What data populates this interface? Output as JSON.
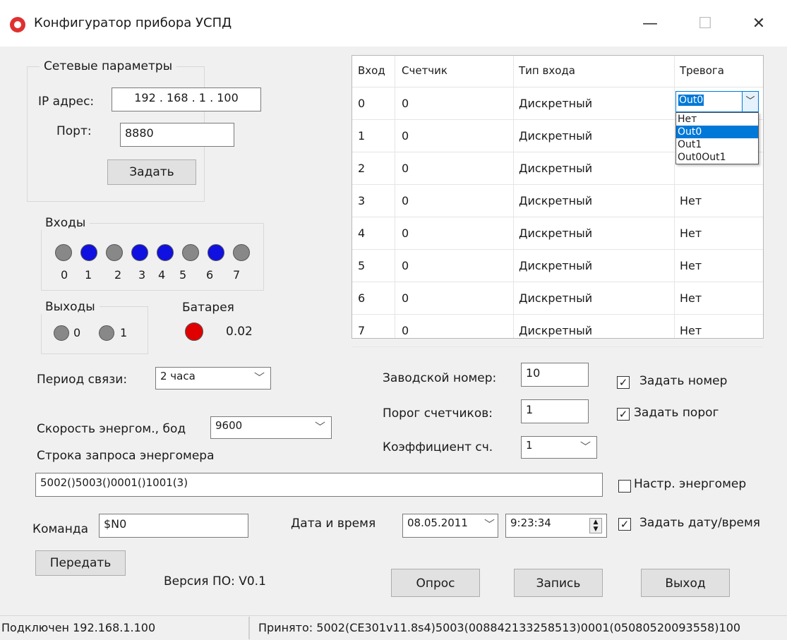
{
  "window": {
    "title": "Конфигуратор прибора УСПД",
    "minimize": "—",
    "maximize": "☐",
    "close": "✕"
  },
  "network": {
    "label": "Сетевые параметры",
    "ip_label": "IP адрес:",
    "ip_value": "192 . 168 .  1   . 100",
    "port_label": "Порт:",
    "port_value": "8880",
    "set_button": "Задать"
  },
  "inputs": {
    "label": "Входы",
    "numbers": [
      "0",
      "1",
      "2",
      "3",
      "4",
      "5",
      "6",
      "7"
    ],
    "states": [
      "off",
      "on",
      "off",
      "on",
      "on",
      "off",
      "on",
      "off"
    ]
  },
  "outputs": {
    "label": "Выходы",
    "numbers": [
      "0",
      "1"
    ]
  },
  "battery": {
    "label": "Батарея",
    "value": "0.02"
  },
  "period": {
    "label": "Период связи:",
    "value": "2 часа"
  },
  "baud": {
    "label": "Скорость энергом., бод",
    "value": "9600"
  },
  "request": {
    "label": "Строка запроса энергомера",
    "value": "5002()5003()0001()1001(3)"
  },
  "command": {
    "label": "Команда",
    "value": "$N0",
    "send_button": "Передать"
  },
  "version": "Версия ПО: V0.1",
  "serial": {
    "label": "Заводской номер:",
    "value": "10",
    "check_label": "Задать номер",
    "checked": true
  },
  "threshold": {
    "label": "Порог счетчиков:",
    "value": "1",
    "check_label": "Задать порог",
    "checked": true
  },
  "coef": {
    "label": "Коэффициент сч.",
    "value": "1"
  },
  "meter_setup": {
    "label": "Настр. энергомер",
    "checked": false
  },
  "datetime": {
    "label": "Дата и время",
    "date": "08.05.2011",
    "time": "9:23:34",
    "check_label": "Задать дату/время",
    "checked": true
  },
  "buttons": {
    "poll": "Опрос",
    "write": "Запись",
    "exit": "Выход"
  },
  "table": {
    "headers": [
      "Вход",
      "Счетчик",
      "Тип входа",
      "Тревога"
    ],
    "rows": [
      [
        "0",
        "0",
        "Дискретный",
        "Out0"
      ],
      [
        "1",
        "0",
        "Дискретный",
        ""
      ],
      [
        "2",
        "0",
        "Дискретный",
        ""
      ],
      [
        "3",
        "0",
        "Дискретный",
        "Нет"
      ],
      [
        "4",
        "0",
        "Дискретный",
        "Нет"
      ],
      [
        "5",
        "0",
        "Дискретный",
        "Нет"
      ],
      [
        "6",
        "0",
        "Дискретный",
        "Нет"
      ],
      [
        "7",
        "0",
        "Дискретный",
        "Нет"
      ]
    ],
    "dropdown_options": [
      "Нет",
      "Out0",
      "Out1",
      "Out0Out1"
    ]
  },
  "status": {
    "connected": "Подключен 192.168.1.100",
    "received": "Принято:  5002(CE301v11.8s4)5003(008842133258513)0001(05080520093558)100"
  },
  "colors": {
    "led_on": "#1010e0",
    "led_off": "#888888",
    "battery_led": "#e00000",
    "selection": "#0078d7"
  }
}
